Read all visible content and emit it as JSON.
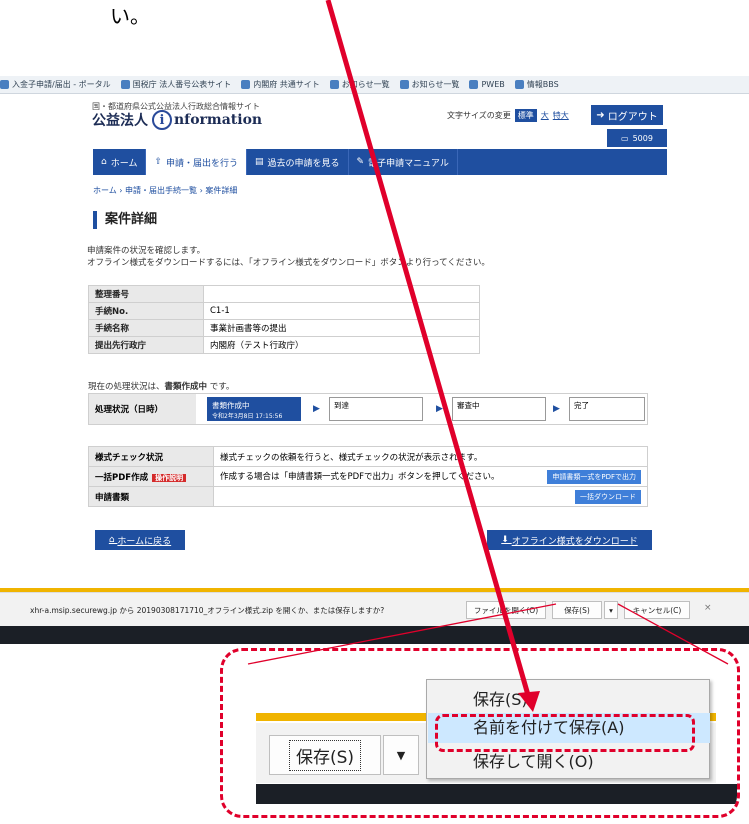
{
  "top_note": "い。",
  "browser": {
    "bookmarks": [
      "入金子申請/届出 - ポータル",
      "国税庁 法人番号公表サイト",
      "内閣府 共通サイト",
      "お知らせ一覧",
      "お知らせ一覧",
      "PWEB",
      "情報BBS"
    ]
  },
  "site": {
    "org_name": "国・都道府県公式公益法人行政総合情報サイト",
    "logo_before": "公益法人",
    "logo_i": "i",
    "logo_after": "nformation",
    "font_size_label": "文字サイズの変更",
    "font_std": "標準",
    "font_large": "大",
    "font_xlarge": "特大",
    "logout": "ログアウト",
    "user_id": "5009",
    "nav": [
      "ホーム",
      "申請・届出を行う",
      "過去の申請を見る",
      "電子申請マニュアル"
    ],
    "breadcrumb": "ホーム › 申請・届出手続一覧 › 案件詳細",
    "page_title": "案件詳細",
    "intro_1": "申請案件の状況を確認します。",
    "intro_2": "オフライン様式をダウンロードするには、「オフライン様式をダウンロード」ボタンより行ってください。",
    "info_rows": [
      {
        "label": "整理番号",
        "value": ""
      },
      {
        "label": "手続No.",
        "value": "C1-1"
      },
      {
        "label": "手続名称",
        "value": "事業計画書等の提出"
      },
      {
        "label": "提出先行政庁",
        "value": "内閣府（テスト行政庁）"
      }
    ],
    "status_prefix": "現在の処理状況は、",
    "status_value": "書類作成中",
    "status_suffix": " です。",
    "status_label": "処理状況（日時）",
    "steps": [
      {
        "name": "書類作成中",
        "date": "令和2年3月8日 17:15:56"
      },
      {
        "name": "到達",
        "date": ""
      },
      {
        "name": "審査中",
        "date": ""
      },
      {
        "name": "完了",
        "date": ""
      }
    ],
    "check_label": "様式チェック状況",
    "check_text": "様式チェックの依頼を行うと、様式チェックの状況が表示されます。",
    "pdf_label": "一括PDF作成",
    "pdf_badge": "操作説明",
    "pdf_text": "作成する場合は「申請書類一式をPDFで出力」ボタンを押してください。",
    "pdf_button": "申請書類一式をPDFで出力",
    "doc_label": "申請書類",
    "doc_button": "一括ダウンロード",
    "home_button": "ホームに戻る",
    "offline_button": "オフライン様式をダウンロード"
  },
  "download_bar": {
    "message": "xhr-a.msip.securewg.jp から 20190308171710_オフライン様式.zip を開くか、または保存しますか?",
    "open_file": "ファイルを開く(O)",
    "save": "保存(S)",
    "dropdown": "▾",
    "cancel": "キャンセル(C)",
    "close": "×"
  },
  "zoom": {
    "save": "保存(S)",
    "dropdown": "▼",
    "menu": [
      "保存(S)",
      "名前を付けて保存(A)",
      "保存して開く(O)"
    ]
  },
  "colors": {
    "accent": "#1f4fa0",
    "annotation": "#e0002b",
    "highlight": "#cde8ff",
    "gold": "#f0b400"
  }
}
